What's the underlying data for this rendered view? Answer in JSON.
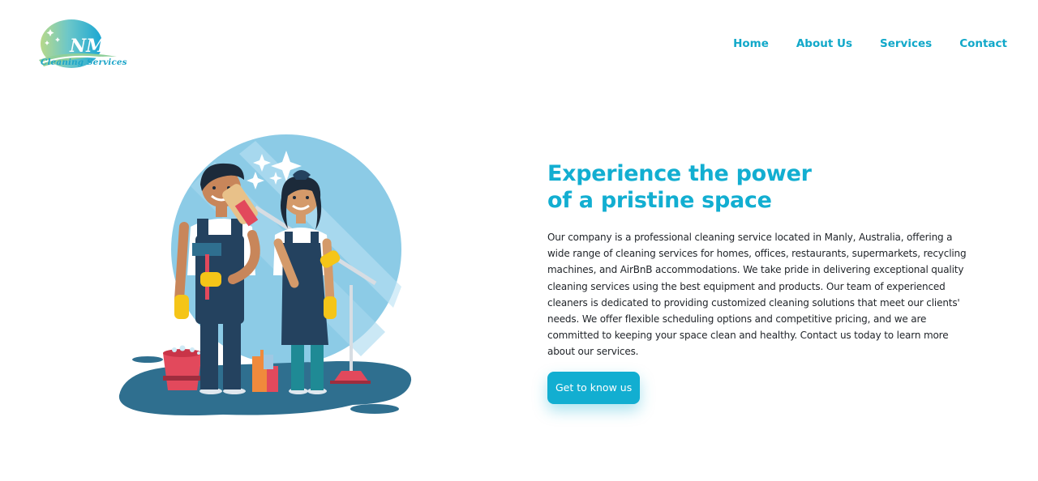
{
  "brand": {
    "logo_mark": "NM",
    "logo_tagline": "Cleaning Services",
    "accent_color": "#12aed1"
  },
  "nav": {
    "items": [
      {
        "label": "Home"
      },
      {
        "label": "About Us"
      },
      {
        "label": "Services"
      },
      {
        "label": "Contact"
      }
    ]
  },
  "hero": {
    "headline_line1": "Experience the power",
    "headline_line2": "of a pristine space",
    "description": "Our company is a professional cleaning service located in Manly, Australia, offering a wide range of cleaning services for homes, offices, restaurants, supermarkets, recycling machines, and AirBnB accommodations. We take pride in delivering exceptional quality cleaning services using the best equipment and products. Our team of experienced cleaners is dedicated to providing customized cleaning solutions that meet our clients' needs. We offer flexible scheduling options and competitive pricing, and we are committed to keeping your space clean and healthy. Contact us today to learn more about our services.",
    "cta_label": "Get to know us",
    "illustration": "two-cleaners-illustration"
  }
}
